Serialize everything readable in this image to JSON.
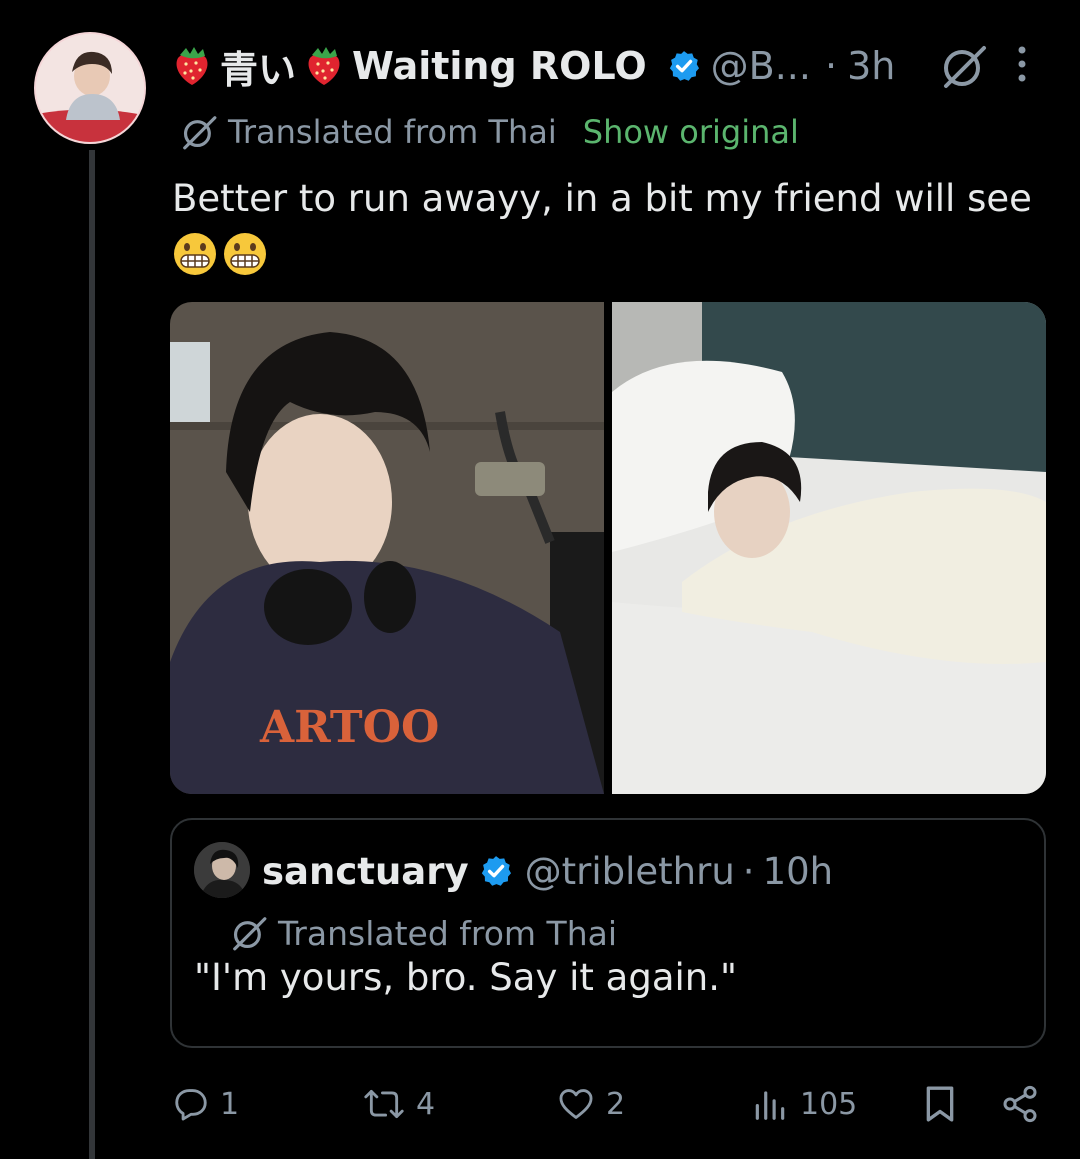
{
  "tweet": {
    "name_text": "青い",
    "name_suffix": "Waiting ROLO",
    "handle": "@B...",
    "separator": "·",
    "time": "3h",
    "translated_label": "Translated from Thai",
    "show_original": "Show original",
    "text": "Better to run awayy, in a bit my friend will see",
    "emojis": [
      "grimacing-face",
      "grimacing-face"
    ]
  },
  "quote": {
    "name": "sanctuary",
    "handle": "@triblethru",
    "separator": "·",
    "time": "10h",
    "translated_label": "Translated from Thai",
    "text": "\"I'm yours, bro. Say it again.\""
  },
  "actions": {
    "replies": "1",
    "reposts": "4",
    "likes": "2",
    "views": "105"
  },
  "icons": [
    "strawberry-icon",
    "verified-badge-icon",
    "grok-icon",
    "more-icon",
    "translate-icon",
    "reply-icon",
    "repost-icon",
    "like-icon",
    "views-icon",
    "bookmark-icon",
    "share-icon"
  ],
  "colors": {
    "background": "#000000",
    "text": "#e7e9ea",
    "muted": "#8b98a5",
    "verified": "#1d9bf0",
    "show_original": "#5bb56e",
    "border": "#2f3336"
  }
}
